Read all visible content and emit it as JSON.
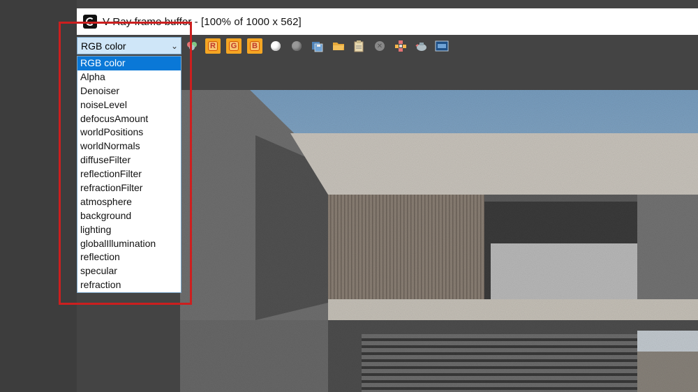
{
  "window": {
    "title": "V-Ray frame buffer - [100% of 1000 x 562]"
  },
  "channel_select": {
    "value": "RGB color",
    "options": [
      "RGB color",
      "Alpha",
      "Denoiser",
      "noiseLevel",
      "defocusAmount",
      "worldPositions",
      "worldNormals",
      "diffuseFilter",
      "reflectionFilter",
      "refractionFilter",
      "atmosphere",
      "background",
      "lighting",
      "globalIllumination",
      "reflection",
      "specular",
      "refraction"
    ]
  },
  "toolbar": {
    "red_channel_label": "R",
    "green_channel_label": "G",
    "blue_channel_label": "B",
    "icons": [
      "color-picker-icon",
      "red-channel-icon",
      "green-channel-icon",
      "blue-channel-icon",
      "show-mono-icon",
      "show-alpha-icon",
      "save-image-icon",
      "load-image-icon",
      "copy-to-clipboard-icon",
      "clear-image-icon",
      "track-mouse-icon",
      "render-region-icon",
      "render-icon"
    ]
  },
  "colors": {
    "highlight_frame": "#cc1f1f",
    "selected_item": "#0a78d7",
    "select_bg": "#cfe6f8",
    "channel_button": "#f5a623",
    "window_bg": "#444444"
  }
}
